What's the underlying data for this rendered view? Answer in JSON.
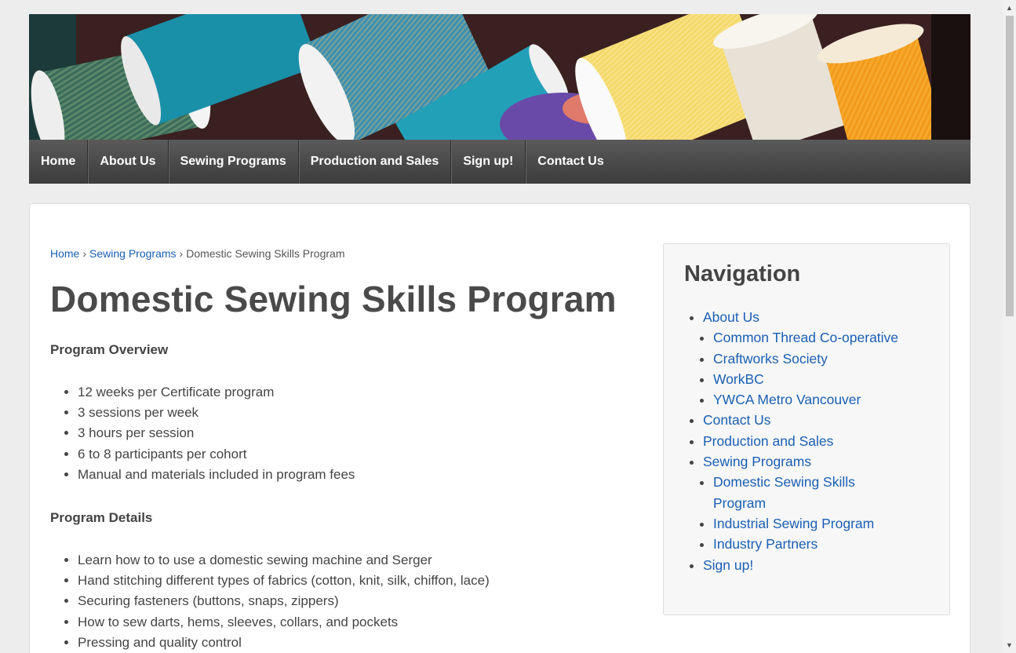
{
  "nav": {
    "items": [
      "Home",
      "About Us",
      "Sewing Programs",
      "Production and Sales",
      "Sign up!",
      "Contact Us"
    ]
  },
  "breadcrumb": {
    "home": "Home",
    "sep": "›",
    "parent": "Sewing Programs",
    "current": "Domestic Sewing Skills Program"
  },
  "page": {
    "title": "Domestic Sewing Skills Program",
    "overview_heading": "Program Overview",
    "overview_items": [
      "12 weeks per Certificate program",
      "3 sessions per week",
      "3 hours per session",
      "6 to 8 participants per cohort",
      "Manual and materials included in program fees"
    ],
    "details_heading": "Program Details",
    "details_items": [
      "Learn how to to use a domestic sewing machine and Serger",
      "Hand stitching different types of fabrics (cotton, knit, silk, chiffon, lace)",
      "Securing fasteners (buttons, snaps, zippers)",
      "How to sew darts, hems, sleeves, collars, and pockets",
      "Pressing and quality control"
    ]
  },
  "sidebar": {
    "title": "Navigation",
    "about": "About Us",
    "about_children": [
      "Common Thread Co-operative",
      "Craftworks Society",
      "WorkBC",
      "YWCA Metro Vancouver"
    ],
    "contact": "Contact Us",
    "production": "Production and Sales",
    "sewing": "Sewing Programs",
    "sewing_children": [
      "Domestic Sewing Skills Program",
      "Industrial Sewing Program",
      "Industry Partners"
    ],
    "signup": "Sign up!"
  },
  "icons": {
    "scroll_up": "scroll-up-arrow-icon",
    "scroll_down": "scroll-down-arrow-icon"
  },
  "colors": {
    "link": "#1a5fb4",
    "nav_bg": "#4a4a4a"
  }
}
